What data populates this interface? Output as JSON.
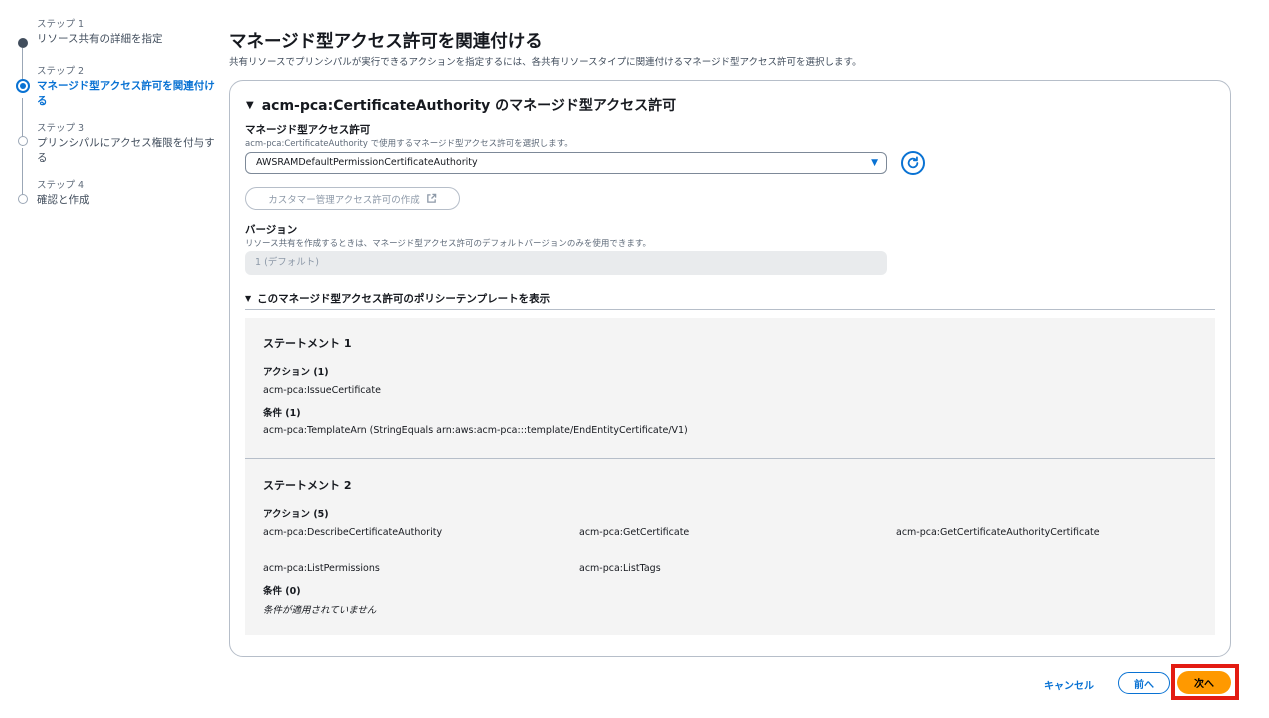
{
  "stepper": {
    "steps": [
      {
        "kicker": "ステップ 1",
        "title": "リソース共有の詳細を指定"
      },
      {
        "kicker": "ステップ 2",
        "title": "マネージド型アクセス許可を関連付ける"
      },
      {
        "kicker": "ステップ 3",
        "title": "プリンシパルにアクセス権限を付与する"
      },
      {
        "kicker": "ステップ 4",
        "title": "確認と作成"
      }
    ]
  },
  "header": {
    "title": "マネージド型アクセス許可を関連付ける",
    "description": "共有リソースでプリンシパルが実行できるアクションを指定するには、各共有リソースタイプに関連付けるマネージド型アクセス許可を選択します。"
  },
  "panel": {
    "title": "acm-pca:CertificateAuthority のマネージド型アクセス許可",
    "permission_label": "マネージド型アクセス許可",
    "permission_desc": "acm-pca:CertificateAuthority で使用するマネージド型アクセス許可を選択します。",
    "permission_value": "AWSRAMDefaultPermissionCertificateAuthority",
    "create_button": "カスタマー管理アクセス許可の作成",
    "version_label": "バージョン",
    "version_desc": "リソース共有を作成するときは、マネージド型アクセス許可のデフォルトバージョンのみを使用できます。",
    "version_value": "1 (デフォルト)",
    "policy_toggle": "このマネージド型アクセス許可のポリシーテンプレートを表示"
  },
  "statements": [
    {
      "title": "ステートメント 1",
      "actions_label": "アクション (1)",
      "actions": [
        "acm-pca:IssueCertificate"
      ],
      "conditions_label": "条件 (1)",
      "condition": "acm-pca:TemplateArn (StringEquals arn:aws:acm-pca:::template/EndEntityCertificate/V1)"
    },
    {
      "title": "ステートメント 2",
      "actions_label": "アクション (5)",
      "actions": [
        "acm-pca:DescribeCertificateAuthority",
        "acm-pca:GetCertificate",
        "acm-pca:GetCertificateAuthorityCertificate",
        "acm-pca:ListPermissions",
        "acm-pca:ListTags"
      ],
      "conditions_label": "条件 (0)",
      "condition": "条件が適用されていません"
    }
  ],
  "footer": {
    "cancel": "キャンセル",
    "previous": "前へ",
    "next": "次へ"
  },
  "colors": {
    "accent": "#0972d3",
    "primary_button": "#ff9900",
    "highlight": "#e31b12"
  }
}
